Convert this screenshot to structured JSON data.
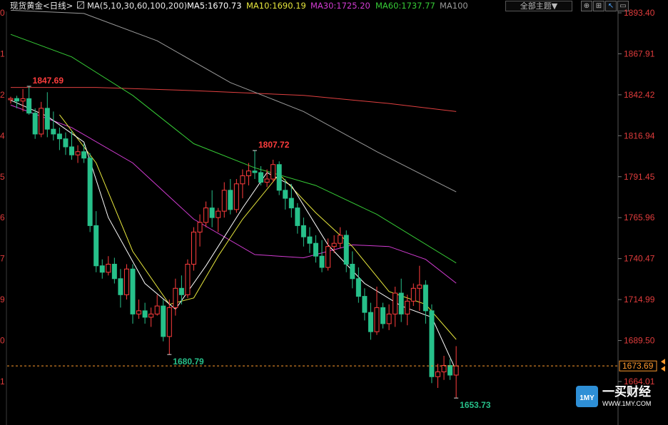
{
  "header": {
    "symbol": "现货黄金",
    "period": "<日线>",
    "indicator": "MA(5,10,30,60,100,200)",
    "ma5": "MA5:1670.73",
    "ma10": "MA10:1690.19",
    "ma30": "MA30:1725.20",
    "ma60": "MA60:1737.77",
    "ma100": "MA100",
    "theme_select": "全部主题▼",
    "toolbar_icons": [
      "fit-icon",
      "grid-icon",
      "cursor-icon",
      "indicator-icon"
    ]
  },
  "colors": {
    "up": "#ff3d3d",
    "down": "#27c08a",
    "ma5": "#ffffff",
    "ma10": "#e6e63c",
    "ma30": "#d23cd2",
    "ma60": "#36cc36",
    "ma100": "#9a9a9a",
    "ma200": "#e04040",
    "axis_text": "#e03c3c",
    "grid": "#2a2a2a",
    "current": "#ff9a2e"
  },
  "chart_data": {
    "type": "candlestick",
    "y_axis_labels": [
      "1893.40",
      "1867.91",
      "1842.42",
      "1816.94",
      "1791.45",
      "1765.96",
      "1740.47",
      "1714.99",
      "1689.50",
      "1664.01"
    ],
    "left_axis_labels": [
      "0",
      "1",
      "2",
      "4",
      "5",
      "6",
      "7",
      "9",
      "0",
      "1"
    ],
    "ylim": [
      1653.73,
      1893.4
    ],
    "current_price": "1673.69",
    "annotations": [
      {
        "label": "1847.69",
        "kind": "high"
      },
      {
        "label": "1807.72",
        "kind": "high"
      },
      {
        "label": "1680.79",
        "kind": "low"
      },
      {
        "label": "1653.73",
        "kind": "low"
      }
    ],
    "candles": [
      [
        1839.3,
        1841.2,
        1837.0,
        1840.1
      ],
      [
        1840.1,
        1841.8,
        1834.0,
        1838.5
      ],
      [
        1838.5,
        1846.0,
        1832.0,
        1840.0
      ],
      [
        1840.0,
        1847.69,
        1830.0,
        1831.0
      ],
      [
        1831.0,
        1834.0,
        1815.0,
        1818.0
      ],
      [
        1818.0,
        1838.0,
        1816.0,
        1834.0
      ],
      [
        1834.0,
        1844.0,
        1816.0,
        1821.0
      ],
      [
        1821.0,
        1832.0,
        1814.0,
        1818.0
      ],
      [
        1818.0,
        1822.0,
        1808.0,
        1815.0
      ],
      [
        1815.0,
        1819.0,
        1805.0,
        1810.0
      ],
      [
        1810.0,
        1820.0,
        1802.0,
        1805.0
      ],
      [
        1805.0,
        1811.0,
        1800.0,
        1807.0
      ],
      [
        1807.0,
        1812.0,
        1800.0,
        1803.0
      ],
      [
        1803.0,
        1806.0,
        1757.0,
        1761.0
      ],
      [
        1761.0,
        1770.0,
        1732.0,
        1736.0
      ],
      [
        1736.0,
        1740.0,
        1728.0,
        1732.0
      ],
      [
        1732.0,
        1742.0,
        1730.0,
        1737.0
      ],
      [
        1737.0,
        1741.0,
        1725.0,
        1728.0
      ],
      [
        1728.0,
        1734.0,
        1710.0,
        1718.0
      ],
      [
        1718.0,
        1737.0,
        1715.0,
        1734.0
      ],
      [
        1734.0,
        1737.0,
        1700.0,
        1706.0
      ],
      [
        1706.0,
        1715.0,
        1703.0,
        1708.0
      ],
      [
        1708.0,
        1713.0,
        1700.0,
        1704.0
      ],
      [
        1704.0,
        1710.0,
        1698.0,
        1706.0
      ],
      [
        1706.0,
        1718.0,
        1705.0,
        1711.0
      ],
      [
        1711.0,
        1715.0,
        1689.0,
        1692.0
      ],
      [
        1692.0,
        1715.0,
        1680.79,
        1710.0
      ],
      [
        1710.0,
        1728.0,
        1705.0,
        1722.0
      ],
      [
        1722.0,
        1730.0,
        1712.0,
        1718.0
      ],
      [
        1718.0,
        1740.0,
        1716.0,
        1737.0
      ],
      [
        1737.0,
        1760.0,
        1733.0,
        1757.0
      ],
      [
        1757.0,
        1768.0,
        1748.0,
        1763.0
      ],
      [
        1763.0,
        1776.0,
        1760.0,
        1772.0
      ],
      [
        1772.0,
        1783.0,
        1760.0,
        1766.0
      ],
      [
        1766.0,
        1772.0,
        1757.0,
        1770.0
      ],
      [
        1770.0,
        1788.0,
        1766.0,
        1783.0
      ],
      [
        1783.0,
        1790.0,
        1768.0,
        1771.0
      ],
      [
        1771.0,
        1790.0,
        1769.0,
        1787.0
      ],
      [
        1787.0,
        1796.0,
        1778.0,
        1792.0
      ],
      [
        1792.0,
        1800.0,
        1786.0,
        1795.0
      ],
      [
        1795.0,
        1807.72,
        1790.0,
        1794.0
      ],
      [
        1794.0,
        1798.0,
        1786.0,
        1788.0
      ],
      [
        1788.0,
        1796.0,
        1785.0,
        1790.0
      ],
      [
        1790.0,
        1802.0,
        1788.0,
        1799.0
      ],
      [
        1799.0,
        1801.0,
        1780.0,
        1783.0
      ],
      [
        1783.0,
        1790.0,
        1771.0,
        1778.0
      ],
      [
        1778.0,
        1787.0,
        1766.0,
        1772.0
      ],
      [
        1772.0,
        1775.0,
        1756.0,
        1761.0
      ],
      [
        1761.0,
        1766.0,
        1748.0,
        1754.0
      ],
      [
        1754.0,
        1760.0,
        1744.0,
        1750.0
      ],
      [
        1750.0,
        1755.0,
        1738.0,
        1742.0
      ],
      [
        1742.0,
        1752.0,
        1732.0,
        1735.0
      ],
      [
        1735.0,
        1753.0,
        1733.0,
        1748.0
      ],
      [
        1748.0,
        1755.0,
        1744.0,
        1750.0
      ],
      [
        1750.0,
        1760.0,
        1747.0,
        1755.0
      ],
      [
        1755.0,
        1758.0,
        1732.0,
        1737.0
      ],
      [
        1737.0,
        1745.0,
        1722.0,
        1728.0
      ],
      [
        1728.0,
        1735.0,
        1713.0,
        1717.0
      ],
      [
        1717.0,
        1722.0,
        1702.0,
        1707.0
      ],
      [
        1707.0,
        1713.0,
        1690.0,
        1695.0
      ],
      [
        1695.0,
        1723.0,
        1693.0,
        1710.0
      ],
      [
        1710.0,
        1713.0,
        1697.0,
        1700.0
      ],
      [
        1700.0,
        1712.0,
        1696.0,
        1706.0
      ],
      [
        1706.0,
        1723.0,
        1698.0,
        1719.0
      ],
      [
        1719.0,
        1728.0,
        1701.0,
        1706.0
      ],
      [
        1706.0,
        1718.0,
        1699.0,
        1714.0
      ],
      [
        1714.0,
        1725.0,
        1711.0,
        1722.0
      ],
      [
        1722.0,
        1736.0,
        1708.0,
        1724.0
      ],
      [
        1724.0,
        1727.0,
        1700.0,
        1708.0
      ],
      [
        1708.0,
        1712.0,
        1663.0,
        1667.0
      ],
      [
        1667.0,
        1675.0,
        1660.0,
        1670.0
      ],
      [
        1670.0,
        1680.0,
        1665.0,
        1674.0
      ],
      [
        1674.0,
        1678.0,
        1665.0,
        1668.0
      ],
      [
        1668.0,
        1686.0,
        1653.73,
        1673.69
      ]
    ],
    "ma_lines": {
      "ma5": [
        [
          0,
          1839
        ],
        [
          6,
          1829
        ],
        [
          12,
          1813
        ],
        [
          16,
          1766
        ],
        [
          22,
          1725
        ],
        [
          27,
          1709
        ],
        [
          32,
          1736
        ],
        [
          38,
          1772
        ],
        [
          42,
          1794
        ],
        [
          46,
          1786
        ],
        [
          52,
          1749
        ],
        [
          58,
          1725
        ],
        [
          64,
          1711
        ],
        [
          69,
          1704
        ],
        [
          73,
          1670.73
        ]
      ],
      "ma10": [
        [
          8,
          1830
        ],
        [
          14,
          1800
        ],
        [
          20,
          1745
        ],
        [
          26,
          1712
        ],
        [
          30,
          1716
        ],
        [
          34,
          1742
        ],
        [
          38,
          1765
        ],
        [
          44,
          1793
        ],
        [
          50,
          1769
        ],
        [
          56,
          1748
        ],
        [
          62,
          1720
        ],
        [
          68,
          1712
        ],
        [
          73,
          1690.19
        ]
      ],
      "ma30": [
        [
          0,
          1836
        ],
        [
          10,
          1822
        ],
        [
          20,
          1800
        ],
        [
          30,
          1765
        ],
        [
          40,
          1743
        ],
        [
          48,
          1741
        ],
        [
          56,
          1749
        ],
        [
          62,
          1748
        ],
        [
          68,
          1740
        ],
        [
          73,
          1725.2
        ]
      ],
      "ma60": [
        [
          0,
          1880
        ],
        [
          10,
          1866
        ],
        [
          20,
          1842
        ],
        [
          30,
          1812
        ],
        [
          40,
          1797
        ],
        [
          50,
          1786
        ],
        [
          60,
          1768
        ],
        [
          73,
          1737.77
        ]
      ],
      "ma100": [
        [
          0,
          1895
        ],
        [
          12,
          1893
        ],
        [
          24,
          1876
        ],
        [
          36,
          1850
        ],
        [
          48,
          1832
        ],
        [
          60,
          1807
        ],
        [
          73,
          1782
        ]
      ],
      "ma200": [
        [
          0,
          1847
        ],
        [
          14,
          1847
        ],
        [
          30,
          1845
        ],
        [
          48,
          1842
        ],
        [
          62,
          1837
        ],
        [
          73,
          1832
        ]
      ]
    }
  },
  "watermark": {
    "brand": "一买财经",
    "url": "WWW.1MY.COM",
    "badge": "1MY"
  }
}
